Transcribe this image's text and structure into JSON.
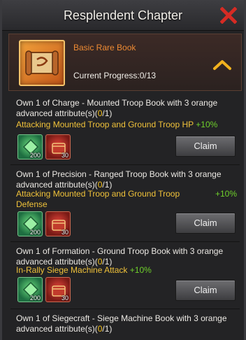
{
  "header": {
    "title": "Resplendent Chapter"
  },
  "book": {
    "name": "Basic Rare Book",
    "progress_label": "Current Progress:0/13"
  },
  "tasks": [
    {
      "desc_pre": "Own 1 of Charge - Mounted Troop Book with 3 orange advanced attribute(s)(",
      "prog_cur": "0",
      "prog_total": "/1)",
      "reward_line": "Attacking Mounted Troop and Ground Troop HP",
      "bonus": "+10%",
      "items": [
        {
          "icon": "green-speedup-icon",
          "count": "200"
        },
        {
          "icon": "red-chest-icon",
          "count": "30"
        }
      ],
      "claim": "Claim"
    },
    {
      "desc_pre": "Own 1 of Precision - Ranged Troop Book with 3 orange advanced attribute(s)(",
      "prog_cur": "0",
      "prog_total": "/1)",
      "reward_line": "Attacking Mounted Troop and Ground Troop Defense",
      "bonus": "+10%",
      "items": [
        {
          "icon": "green-speedup-icon",
          "count": "200"
        },
        {
          "icon": "red-chest-icon",
          "count": "30"
        }
      ],
      "claim": "Claim"
    },
    {
      "desc_pre": "Own 1 of Formation - Ground Troop Book with 3 orange advanced attribute(s)(",
      "prog_cur": "0",
      "prog_total": "/1)",
      "reward_line": "In-Rally Siege Machine Attack",
      "bonus": "+10%",
      "items": [
        {
          "icon": "green-speedup-icon",
          "count": "200"
        },
        {
          "icon": "red-chest-icon",
          "count": "30"
        }
      ],
      "claim": "Claim"
    },
    {
      "desc_pre": "Own 1 of Siegecraft - Siege Machine Book with 3 orange advanced attribute(s)(",
      "prog_cur": "0",
      "prog_total": "/1)"
    }
  ],
  "colors": {
    "accent_orange": "#ee8a33",
    "progress_yellow": "#f4c11c",
    "bonus_green": "#6fd12b",
    "close_red": "#d62b24"
  }
}
